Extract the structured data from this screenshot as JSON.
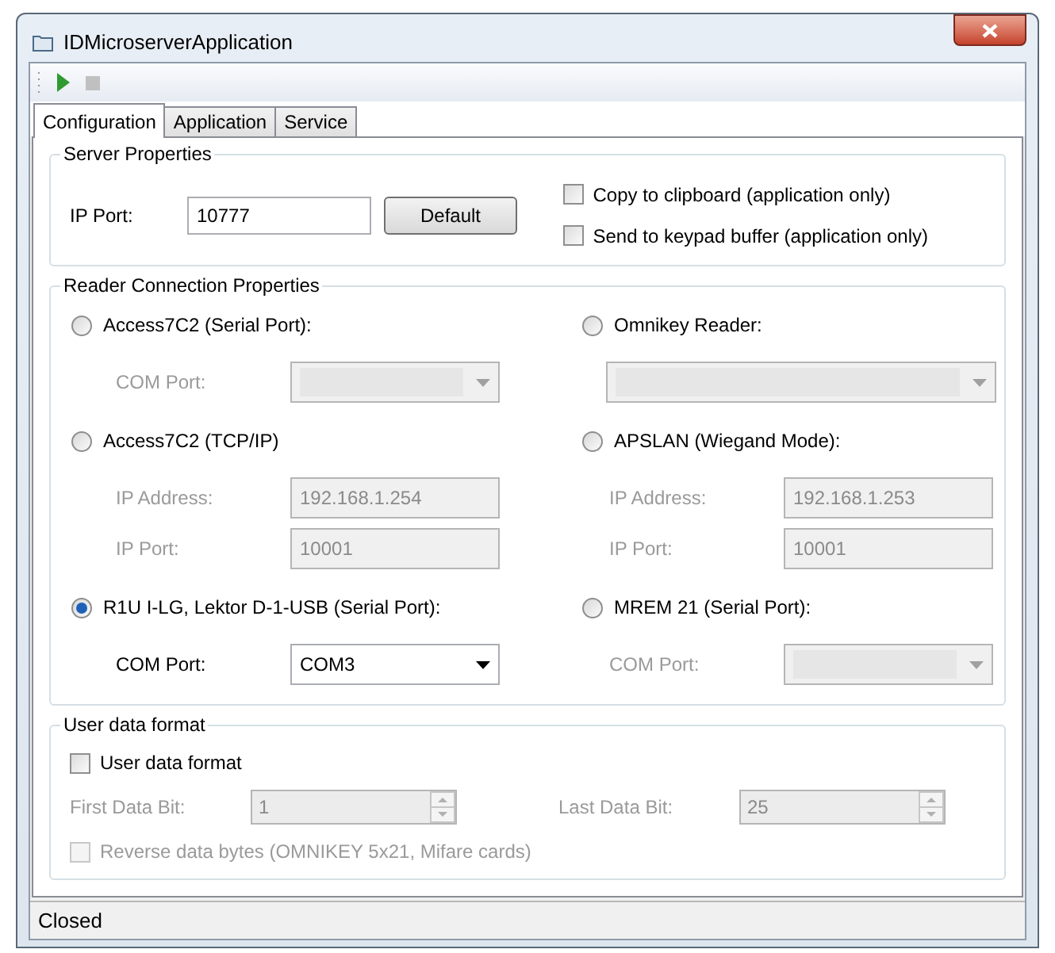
{
  "window": {
    "title": "IDMicroserverApplication"
  },
  "toolbar": [
    {
      "kind": "play",
      "disabled": false
    },
    {
      "kind": "stop",
      "disabled": true
    }
  ],
  "tabs": [
    {
      "label": "Configuration",
      "selected": true
    },
    {
      "label": "Application",
      "selected": false
    },
    {
      "label": "Service",
      "selected": false
    }
  ],
  "server_properties": {
    "title": "Server Properties",
    "ip_port": {
      "label": "IP Port:",
      "value": "10777"
    },
    "default_button": "Default",
    "options": [
      {
        "label": "Copy to clipboard (application only)",
        "checked": false
      },
      {
        "label": "Send to keypad buffer (application only)",
        "checked": false
      }
    ]
  },
  "reader_connection": {
    "title": "Reader Connection Properties",
    "readers": [
      {
        "label": "Access7C2 (Serial Port):",
        "selected": false,
        "fields": [
          {
            "kind": "dropdown",
            "label": "COM Port:",
            "disabled": true
          }
        ]
      },
      {
        "label": "Omnikey Reader:",
        "selected": false,
        "fields": [
          {
            "kind": "dropdown",
            "disabled": true
          }
        ]
      },
      {
        "label": "Access7C2 (TCP/IP)",
        "selected": false,
        "fields": [
          {
            "kind": "text",
            "label": "IP Address:",
            "value": "192.168.1.254",
            "disabled": true
          },
          {
            "kind": "text",
            "label": "IP Port:",
            "value": "10001",
            "disabled": true
          }
        ]
      },
      {
        "label": "APSLAN (Wiegand Mode):",
        "selected": false,
        "fields": [
          {
            "kind": "text",
            "label": "IP Address:",
            "value": "192.168.1.253",
            "disabled": true
          },
          {
            "kind": "text",
            "label": "IP Port:",
            "value": "10001",
            "disabled": true
          }
        ]
      },
      {
        "label": "R1U I-LG, Lektor D-1-USB (Serial Port):",
        "selected": true,
        "fields": [
          {
            "kind": "dropdown",
            "label": "COM Port:",
            "value": "COM3",
            "disabled": false
          }
        ]
      },
      {
        "label": "MREM 21 (Serial Port):",
        "selected": false,
        "fields": [
          {
            "kind": "dropdown",
            "label": "COM Port:",
            "disabled": true
          }
        ]
      }
    ]
  },
  "user_data_format": {
    "title": "User data format",
    "enable": {
      "label": "User data format",
      "checked": false,
      "disabled": false
    },
    "spinners": [
      {
        "label": "First Data Bit:",
        "value": "1",
        "disabled": true
      },
      {
        "label": "Last Data Bit:",
        "value": "25",
        "disabled": true
      }
    ],
    "reverse": {
      "label": "Reverse data bytes (OMNIKEY 5x21, Mifare cards)",
      "checked": false,
      "disabled": true
    }
  },
  "status_bar": {
    "text": "Closed"
  }
}
